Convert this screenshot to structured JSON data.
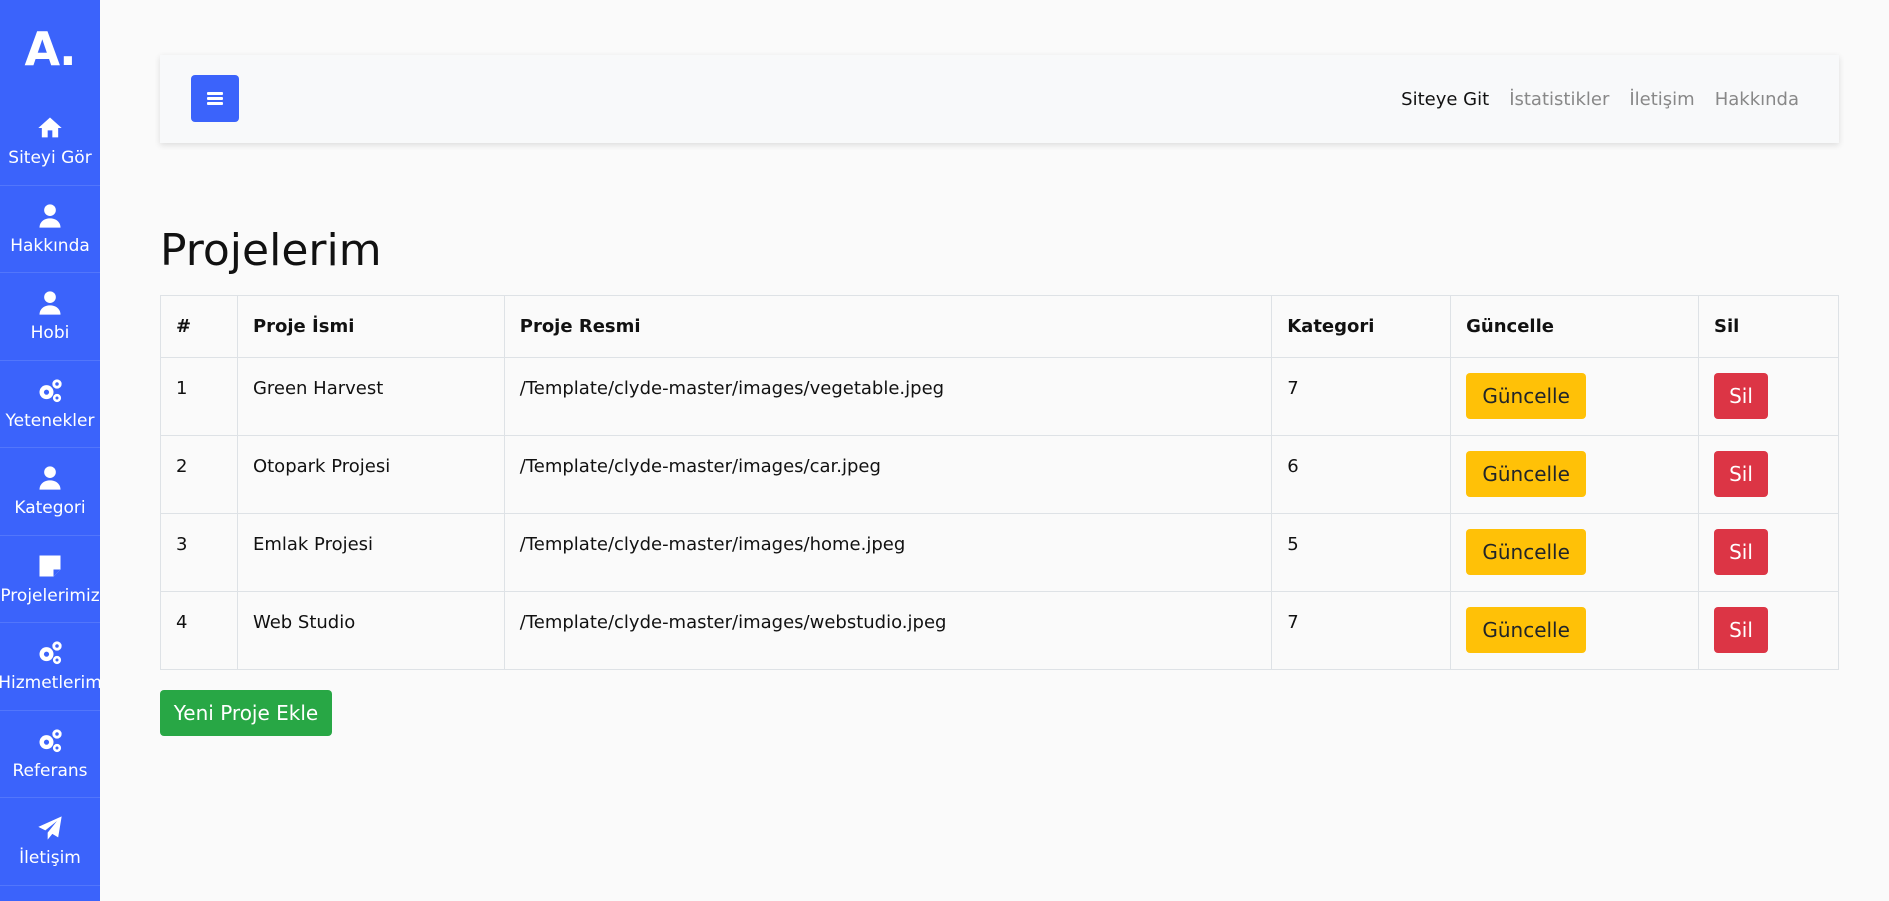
{
  "sidebar": {
    "logo_letter": "A",
    "logo_dot": ".",
    "items": [
      {
        "label": "Siteyi Gör",
        "icon": "home-icon"
      },
      {
        "label": "Hakkında",
        "icon": "user-icon"
      },
      {
        "label": "Hobi",
        "icon": "user-icon"
      },
      {
        "label": "Yetenekler",
        "icon": "gears-icon"
      },
      {
        "label": "Kategori",
        "icon": "user-icon"
      },
      {
        "label": "Projelerimiz",
        "icon": "sticky-note-icon"
      },
      {
        "label": "Hizmetlerim",
        "icon": "gears-icon"
      },
      {
        "label": "Referans",
        "icon": "gears-icon"
      },
      {
        "label": "İletişim",
        "icon": "paper-plane-icon"
      }
    ]
  },
  "topbar": {
    "menu_icon": "bars-icon",
    "links": [
      "Siteye Git",
      "İstatistikler",
      "İletişim",
      "Hakkında"
    ]
  },
  "page": {
    "title": "Projelerim"
  },
  "table": {
    "headers": [
      "#",
      "Proje İsmi",
      "Proje Resmi",
      "Kategori",
      "Güncelle",
      "Sil"
    ],
    "rows": [
      {
        "id": "1",
        "name": "Green Harvest",
        "image": "/Template/clyde-master/images/vegetable.jpeg",
        "category": "7"
      },
      {
        "id": "2",
        "name": "Otopark Projesi",
        "image": "/Template/clyde-master/images/car.jpeg",
        "category": "6"
      },
      {
        "id": "3",
        "name": "Emlak Projesi",
        "image": "/Template/clyde-master/images/home.jpeg",
        "category": "5"
      },
      {
        "id": "4",
        "name": "Web Studio",
        "image": "/Template/clyde-master/images/webstudio.jpeg",
        "category": "7"
      }
    ],
    "update_label": "Güncelle",
    "delete_label": "Sil"
  },
  "actions": {
    "add_label": "Yeni Proje Ekle"
  },
  "colors": {
    "sidebar": "#3b63fb",
    "warning": "#ffc107",
    "danger": "#dc3545",
    "success": "#28a745"
  }
}
